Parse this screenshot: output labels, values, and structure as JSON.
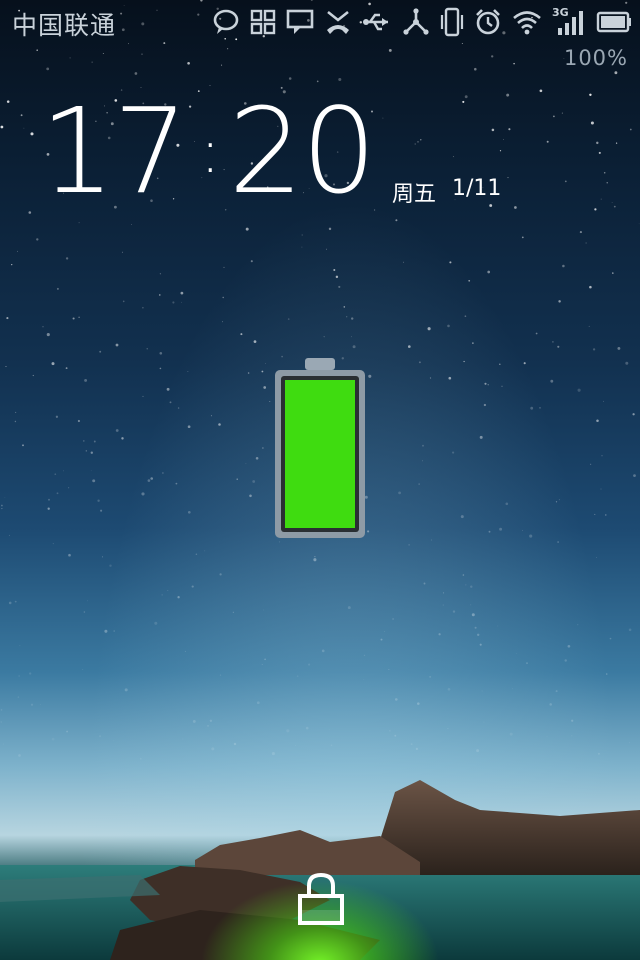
{
  "status_bar": {
    "carrier": "中国联通",
    "network_type": "3G",
    "icons": [
      "chat-bubble-icon",
      "grid-apps-icon",
      "message-icon",
      "missed-call-icon",
      "usb-icon",
      "share-icon",
      "vibrate-icon",
      "alarm-icon",
      "wifi-icon",
      "signal-3g-icon",
      "battery-full-icon"
    ],
    "battery_percent": "100%"
  },
  "lockscreen": {
    "hour": "17",
    "colon": ":",
    "minute": "20",
    "weekday": "周五",
    "date": "1/11",
    "charging_level": 1.0,
    "lock_icon": "padlock-icon"
  },
  "colors": {
    "battery_fill": "#3fdc10",
    "glow": "#7cff30",
    "text": "#ffffff",
    "status_text": "#c9d2da"
  }
}
